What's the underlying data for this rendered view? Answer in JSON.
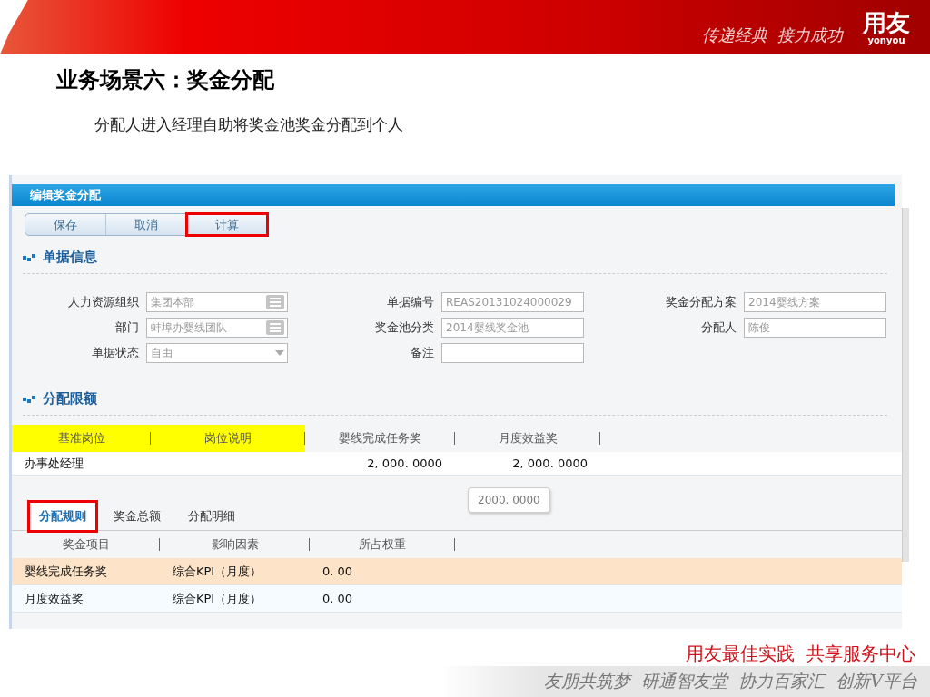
{
  "banner": {
    "slogan": "传递经典  接力成功",
    "logo": "用友",
    "logo_sub": "yonyou"
  },
  "title": "业务场景六：奖金分配",
  "subtitle": "分配人进入经理自助将奖金池奖金分配到个人",
  "app": {
    "window_title": "编辑奖金分配",
    "toolbar": [
      {
        "label": "保存",
        "highlighted": false
      },
      {
        "label": "取消",
        "highlighted": false
      },
      {
        "label": "计算",
        "highlighted": true
      }
    ],
    "info_section": {
      "title": "单据信息",
      "fields": [
        {
          "label": "人力资源组织",
          "value": "集团本部",
          "kind": "ref"
        },
        {
          "label": "单据编号",
          "value": "REAS20131024000029",
          "kind": "text"
        },
        {
          "label": "奖金分配方案",
          "value": "2014婴线方案",
          "kind": "text"
        },
        {
          "label": "部门",
          "value": "蚌埠办婴线团队",
          "kind": "ref"
        },
        {
          "label": "奖金池分类",
          "value": "2014婴线奖金池",
          "kind": "text"
        },
        {
          "label": "分配人",
          "value": "陈俊",
          "kind": "text"
        },
        {
          "label": "单据状态",
          "value": "自由",
          "kind": "select"
        },
        {
          "label": "备注",
          "kind": "text"
        }
      ]
    },
    "limit_section": {
      "title": "分配限额",
      "columns": [
        {
          "label": "基准岗位",
          "highlighted": true
        },
        {
          "label": "岗位说明",
          "highlighted": true
        },
        {
          "label": "婴线完成任务奖",
          "highlighted": false
        },
        {
          "label": "月度效益奖",
          "highlighted": false
        }
      ],
      "rows": [
        {
          "cells": [
            "办事处经理",
            "",
            "2, 000. 0000",
            "2, 000. 0000"
          ]
        }
      ],
      "tooltip": "2000. 0000"
    },
    "tabs": [
      {
        "label": "分配规则",
        "selected": true,
        "highlighted": true
      },
      {
        "label": "奖金总额",
        "selected": false,
        "highlighted": false
      },
      {
        "label": "分配明细",
        "selected": false,
        "highlighted": false
      }
    ],
    "rules": {
      "columns": [
        "奖金项目",
        "影响因素",
        "所占权重"
      ],
      "rows": [
        {
          "cells": [
            "婴线完成任务奖",
            "综合KPI（月度）",
            "0. 00"
          ],
          "selected": true
        },
        {
          "cells": [
            "月度效益奖",
            "综合KPI（月度）",
            "0. 00"
          ],
          "selected": false
        }
      ]
    }
  },
  "footer": {
    "tagline": "用友最佳实践  共享服务中心",
    "motto": "友朋共筑梦  研通智友堂  协力百家汇  创新V平台"
  }
}
